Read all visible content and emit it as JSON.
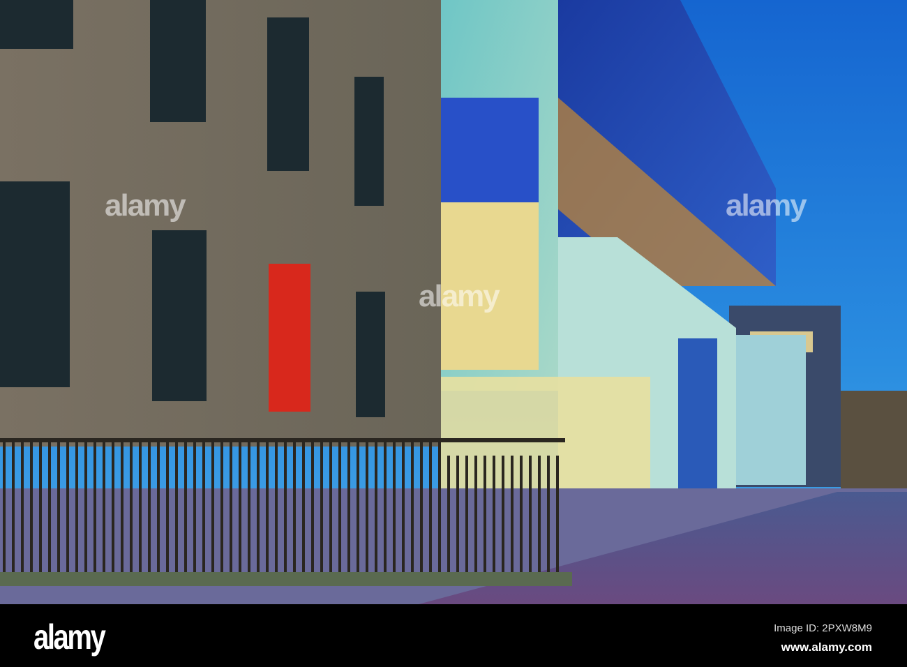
{
  "watermark": {
    "text": "alamy"
  },
  "footer": {
    "logo": "alamy",
    "image_id": "Image ID: 2PXW8M9",
    "url": "www.alamy.com"
  },
  "colors": {
    "sky": "#1f7fd6",
    "stone": "#6f6a5f",
    "glass": "#2a4fb8",
    "panel": "#7ec8c0",
    "window_red": "#d8281c"
  }
}
